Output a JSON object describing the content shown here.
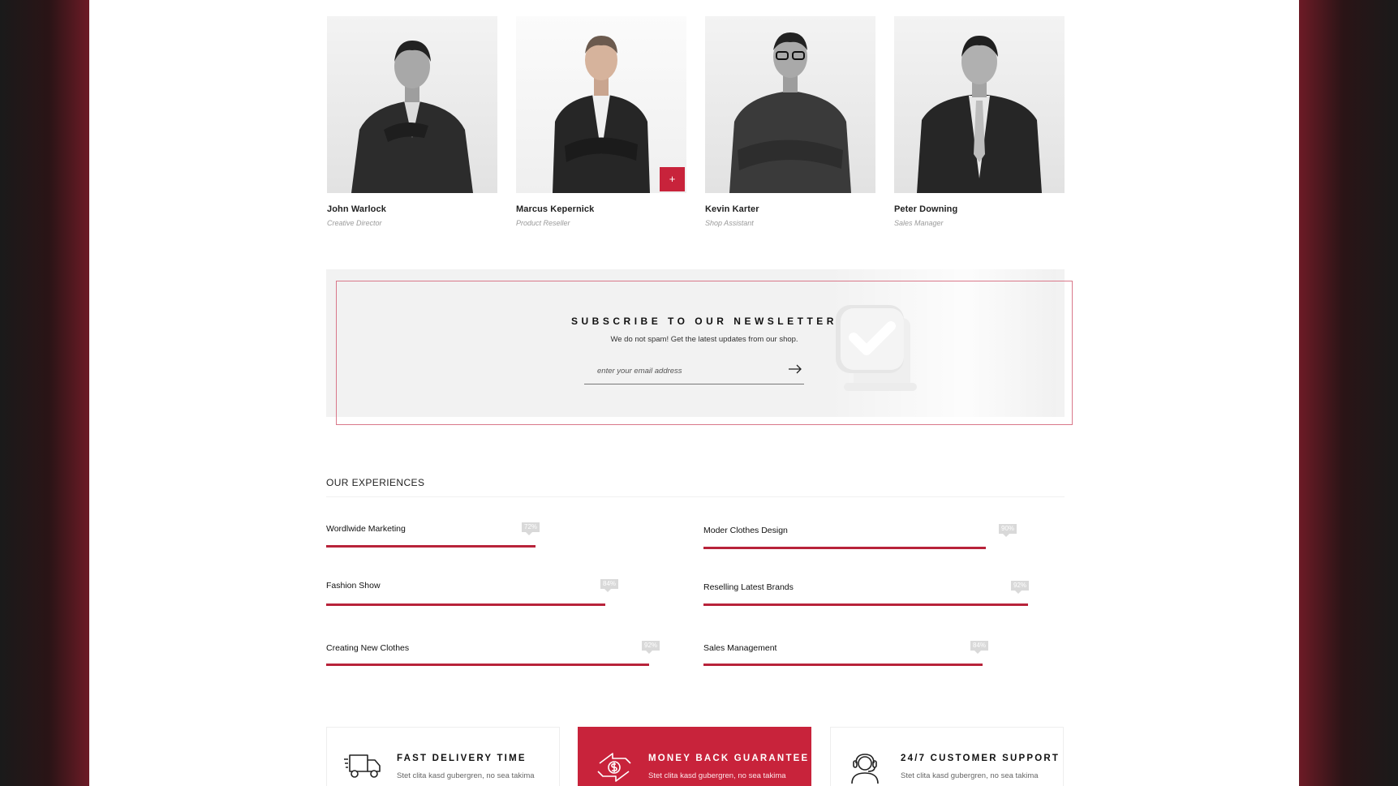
{
  "team": [
    {
      "name": "John Warlock",
      "role": "Creative Director"
    },
    {
      "name": "Marcus Kepernick",
      "role": "Product Reseller",
      "action_icon": "+"
    },
    {
      "name": "Kevin Karter",
      "role": "Shop Assistant"
    },
    {
      "name": "Peter Downing",
      "role": "Sales Manager"
    }
  ],
  "newsletter": {
    "title": "SUBSCRIBE TO OUR NEWSLETTER",
    "subtitle": "We do not spam! Get the latest updates from our shop.",
    "email_placeholder": "enter your email address",
    "submit_icon": "arrow-right-icon"
  },
  "experiences": {
    "title": "OUR EXPERIENCES",
    "skills": [
      {
        "label": "Wordlwide Marketing",
        "percent": 72,
        "percent_label": "72%"
      },
      {
        "label": "Moder Clothes Design",
        "percent": 90,
        "percent_label": "90%"
      },
      {
        "label": "Fashion Show",
        "percent": 84,
        "percent_label": "84%"
      },
      {
        "label": "Reselling Latest Brands",
        "percent": 92,
        "percent_label": "92%"
      },
      {
        "label": "Creating New Clothes",
        "percent": 92,
        "percent_label": "92%"
      },
      {
        "label": "Sales Management",
        "percent": 84,
        "percent_label": "84%"
      }
    ]
  },
  "features": [
    {
      "title": "FAST DELIVERY TIME",
      "text": "Stet clita kasd gubergren, no sea takima",
      "icon": "delivery-truck-icon"
    },
    {
      "title": "MONEY BACK GUARANTEE",
      "text": "Stet clita kasd gubergren, no sea takima",
      "icon": "money-exchange-icon"
    },
    {
      "title": "24/7 CUSTOMER SUPPORT",
      "text": "Stet clita kasd gubergren, no sea takima",
      "icon": "headset-support-icon"
    }
  ],
  "colors": {
    "accent": "#c8233b",
    "frame": "#d9788a",
    "track_fill": "#b8233a"
  }
}
